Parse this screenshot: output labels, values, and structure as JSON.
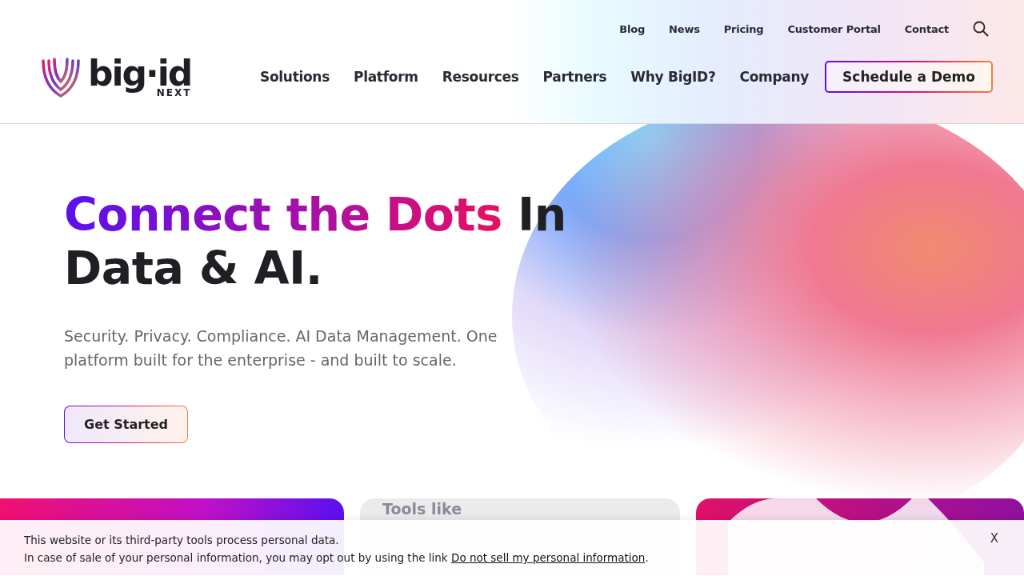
{
  "utility_nav": [
    "Blog",
    "News",
    "Pricing",
    "Customer Portal",
    "Contact"
  ],
  "logo": {
    "wordmark": "big·id",
    "tagline": "NEXT"
  },
  "main_nav": [
    "Solutions",
    "Platform",
    "Resources",
    "Partners",
    "Why BigID?",
    "Company"
  ],
  "cta": "Schedule a Demo",
  "hero": {
    "headline_highlight": "Connect the Dots",
    "headline_rest": "In Data & AI.",
    "subtitle": "Security. Privacy. Compliance. AI Data Management. One platform built for the enterprise - and built to scale.",
    "button": "Get Started"
  },
  "cards": [
    {
      "kind": "gradient"
    },
    {
      "kind": "text",
      "title": "Tools like"
    },
    {
      "kind": "pattern"
    }
  ],
  "cookie_banner": {
    "line_1": "This website or its third-party tools process personal data.",
    "line_2": "In case of sale of your personal information, you may opt out by using the link ",
    "link": "Do not sell my personal information",
    "line_end": ".",
    "close": "X"
  }
}
